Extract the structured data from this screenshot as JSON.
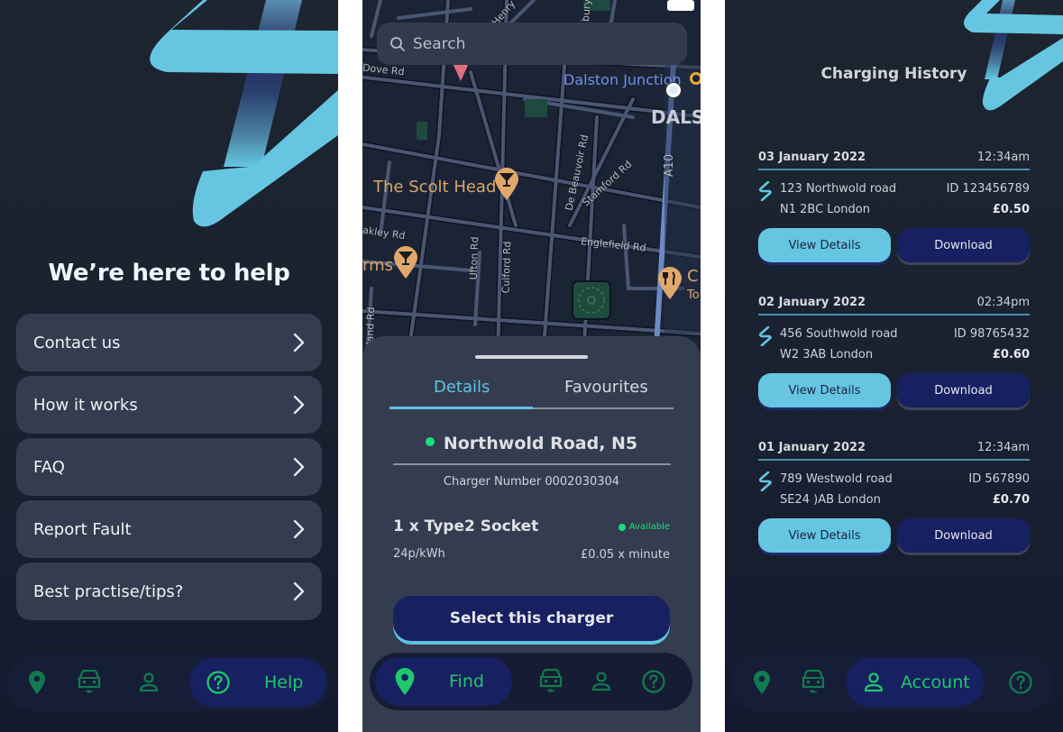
{
  "colors": {
    "accent_cyan": "#66c6e2",
    "navy_button": "#172060",
    "nav_green": "#1fc86a",
    "available_green": "#18e07a",
    "card_bg": "#343d4f"
  },
  "help_screen": {
    "title": "We’re here to help",
    "menu_items": [
      {
        "label": "Contact us",
        "icon": "chevron-right-icon"
      },
      {
        "label": "How it works",
        "icon": "chevron-right-icon"
      },
      {
        "label": "FAQ",
        "icon": "chevron-right-icon"
      },
      {
        "label": "Report Fault",
        "icon": "chevron-right-icon"
      },
      {
        "label": "Best practise/tips?",
        "icon": "chevron-right-icon"
      }
    ],
    "nav": {
      "items": [
        {
          "name": "find",
          "icon": "map-pin-icon"
        },
        {
          "name": "vehicle",
          "icon": "car-charging-icon"
        },
        {
          "name": "account",
          "icon": "user-icon"
        },
        {
          "name": "help",
          "icon": "help-circle-icon",
          "label": "Help",
          "active": true
        }
      ]
    }
  },
  "find_screen": {
    "search": {
      "placeholder": "Search",
      "value": ""
    },
    "map": {
      "street_labels": [
        "Dove Rd",
        "De Beauvoir Rd",
        "Stamford Rd",
        "A10",
        "akley Rd",
        "Ufton Rd",
        "Culford Rd",
        "Englefield Rd",
        "land Rd",
        "Henry",
        "bury"
      ],
      "place_labels": {
        "station": "Dalston Junction",
        "area": "DALS",
        "pub1": "The Scolt Head",
        "pub2": "rms",
        "restaurant": "C",
        "restaurant_sub": "To"
      }
    },
    "tabs": [
      {
        "label": "Details",
        "active": true
      },
      {
        "label": "Favourites",
        "active": false
      }
    ],
    "location": {
      "name": "Northwold Road, N5",
      "status_color": "#18e07a",
      "charger_number": "Charger Number 0002030304"
    },
    "socket": {
      "title": "1 x Type2 Socket",
      "availability": "Available",
      "rate": "24p/kWh",
      "time_rate": "£0.05 x minute"
    },
    "select_button": "Select this charger",
    "nav": {
      "active_label": "Find"
    }
  },
  "history_screen": {
    "title": "Charging History",
    "entries": [
      {
        "date": "03 January 2022",
        "time": "12:34am",
        "address_line1": "123 Northwold road",
        "address_line2": "N1 2BC London",
        "id": "ID 123456789",
        "price": "£0.50",
        "view_label": "View Details",
        "download_label": "Download"
      },
      {
        "date": "02 January 2022",
        "time": "02:34pm",
        "address_line1": "456 Southwold road",
        "address_line2": "W2 3AB London",
        "id": "ID 98765432",
        "price": "£0.60",
        "view_label": "View Details",
        "download_label": "Download"
      },
      {
        "date": "01 January 2022",
        "time": "12:34am",
        "address_line1": "789 Westwold road",
        "address_line2": "SE24 )AB London",
        "id": "ID 567890",
        "price": "£0.70",
        "view_label": "View Details",
        "download_label": "Download"
      }
    ],
    "nav": {
      "active_label": "Account"
    }
  }
}
